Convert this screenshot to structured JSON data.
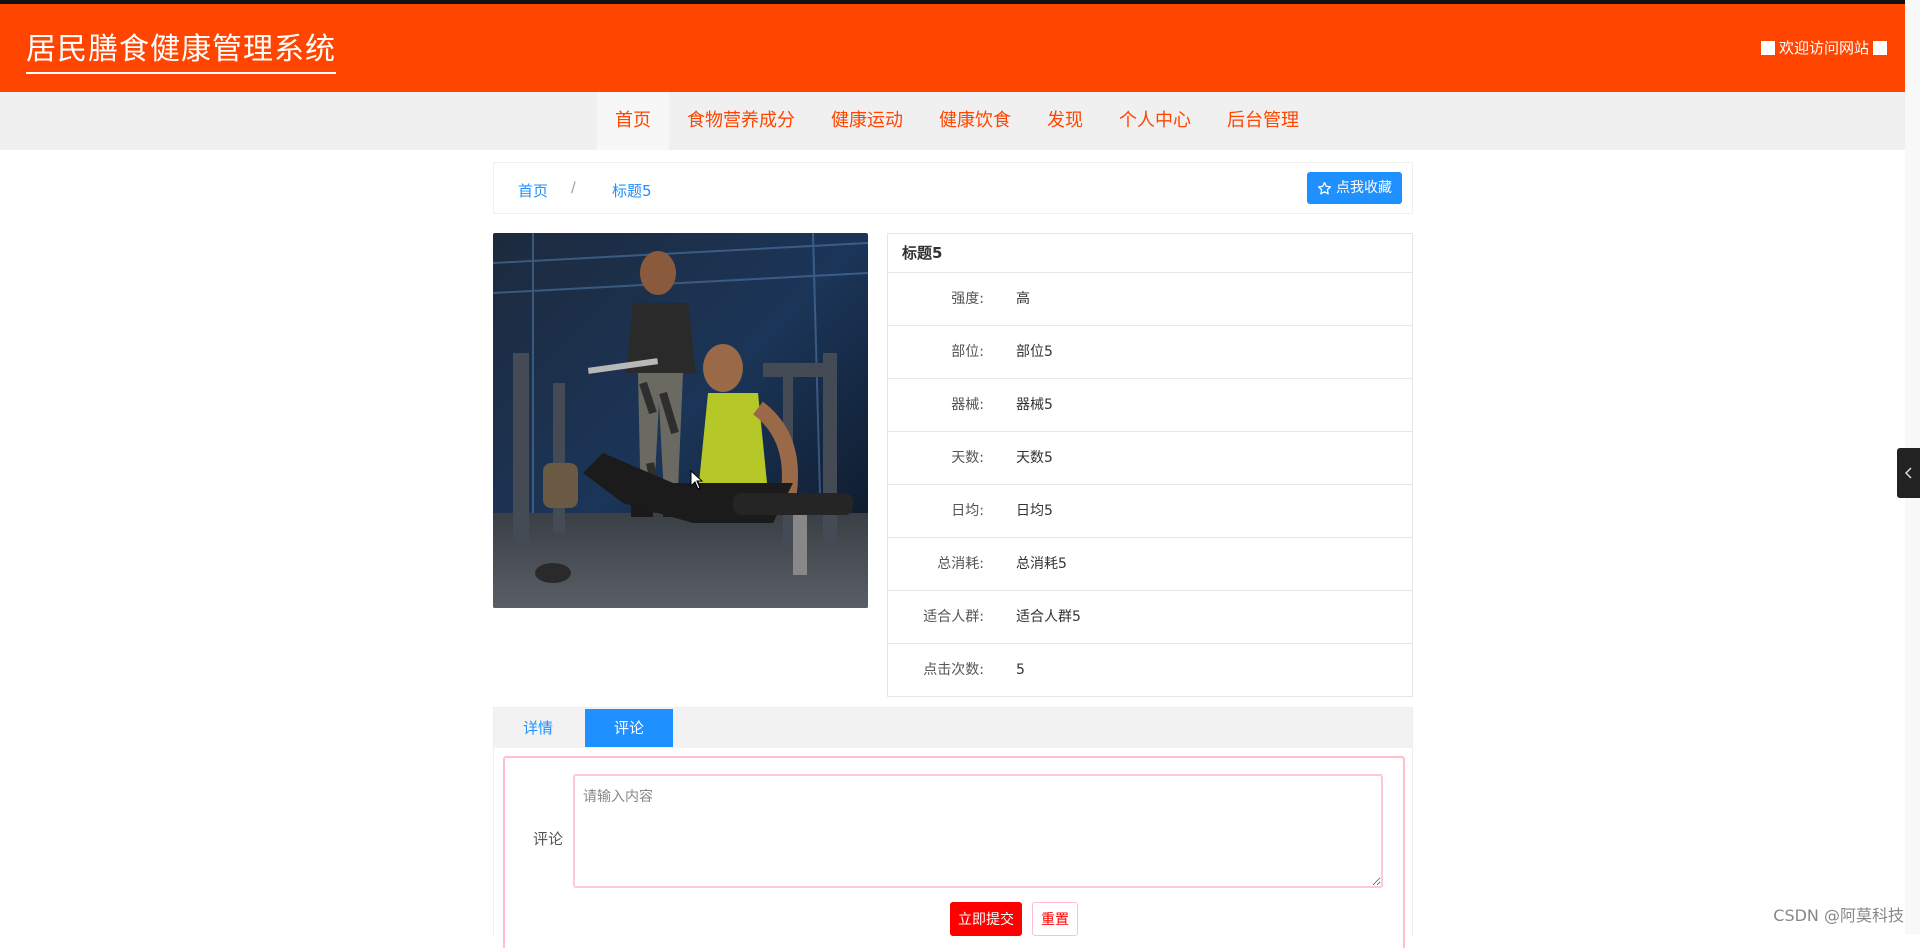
{
  "header": {
    "site_title": "居民膳食健康管理系统",
    "welcome_text": "欢迎访问网站"
  },
  "nav": {
    "items": [
      {
        "label": "首页",
        "active": true
      },
      {
        "label": "食物营养成分",
        "active": false
      },
      {
        "label": "健康运动",
        "active": false
      },
      {
        "label": "健康饮食",
        "active": false
      },
      {
        "label": "发现",
        "active": false
      },
      {
        "label": "个人中心",
        "active": false
      },
      {
        "label": "后台管理",
        "active": false
      }
    ]
  },
  "breadcrumb": {
    "home": "首页",
    "separator": "/",
    "current": "标题5",
    "collect_label": "点我收藏"
  },
  "detail": {
    "title": "标题5",
    "rows": [
      {
        "label": "强度:",
        "value": "高"
      },
      {
        "label": "部位:",
        "value": "部位5"
      },
      {
        "label": "器械:",
        "value": "器械5"
      },
      {
        "label": "天数:",
        "value": "天数5"
      },
      {
        "label": "日均:",
        "value": "日均5"
      },
      {
        "label": "总消耗:",
        "value": "总消耗5"
      },
      {
        "label": "适合人群:",
        "value": "适合人群5"
      },
      {
        "label": "点击次数:",
        "value": "5"
      }
    ]
  },
  "tabs": {
    "detail_label": "详情",
    "comment_label": "评论",
    "active": "评论"
  },
  "comment": {
    "label": "评论",
    "placeholder": "请输入内容",
    "submit_label": "立即提交",
    "reset_label": "重置"
  },
  "watermark": "CSDN @阿莫科技",
  "colors": {
    "header_bg": "#ff4500",
    "accent_blue": "#1e90ff",
    "submit_red": "#ff0000"
  }
}
